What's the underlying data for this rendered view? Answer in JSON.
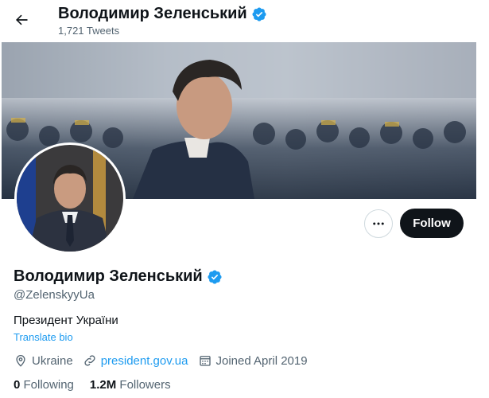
{
  "header": {
    "name": "Володимир Зеленський",
    "tweet_count": "1,721 Tweets"
  },
  "profile": {
    "name": "Володимир Зеленський",
    "handle": "@ZelenskyyUa",
    "bio": "Президент України",
    "translate_label": "Translate bio",
    "location": "Ukraine",
    "website": "president.gov.ua",
    "joined": "Joined April 2019",
    "following_count": "0",
    "following_label": "Following",
    "followers_count": "1.2M",
    "followers_label": "Followers"
  },
  "actions": {
    "follow_label": "Follow"
  },
  "icons": {
    "back": "arrow-left-icon",
    "verified": "verified-badge-icon",
    "more": "more-dots-icon",
    "location": "location-pin-icon",
    "link": "link-icon",
    "calendar": "calendar-icon"
  },
  "colors": {
    "accent": "#1d9bf0",
    "text": "#0f1419",
    "secondary": "#536471",
    "follow_bg": "#0f1419"
  }
}
